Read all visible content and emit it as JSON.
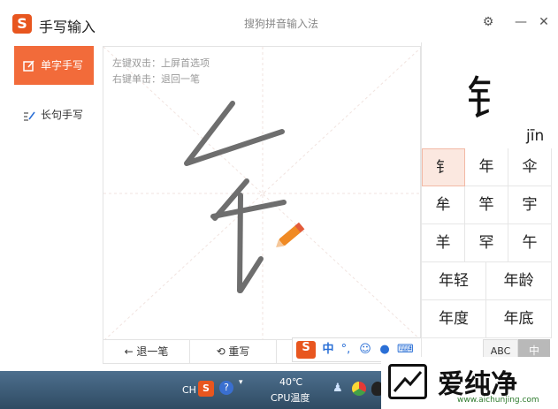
{
  "titlebar": {
    "logo_letter": "S",
    "app_title": "手写输入",
    "ime_title": "搜狗拼音输入法",
    "settings_glyph": "⚙",
    "minimize_glyph": "—",
    "close_glyph": "✕"
  },
  "sidebar": {
    "items": [
      {
        "label": "单字手写",
        "icon": "single-char-icon",
        "active": true
      },
      {
        "label": "长句手写",
        "icon": "long-sentence-icon",
        "active": false
      }
    ]
  },
  "pad": {
    "hint_line1": "左键双击：上屏首选项",
    "hint_line2": "右键单击：退回一笔"
  },
  "bottom_bar": {
    "undo_label": "← 退一笔",
    "rewrite_label": "⟲ 重写"
  },
  "toolstrip": {
    "logo_letter": "S",
    "mode": "中"
  },
  "candidates": {
    "preview_char": "钅",
    "pinyin": "jīn",
    "rows": [
      [
        "钅",
        "年",
        "伞"
      ],
      [
        "牟",
        "竿",
        "宇"
      ],
      [
        "羊",
        "罕",
        "午"
      ],
      [
        "年轻",
        "年龄"
      ],
      [
        "年度",
        "年底"
      ]
    ],
    "selected_index": 0
  },
  "mode_buttons": {
    "abc": "ABC",
    "zh": "中"
  },
  "taskbar": {
    "lang": "CH",
    "temp": "40℃",
    "temp_label": "CPU温度"
  },
  "watermark": {
    "text": "爱纯净",
    "url": "www.aichunjing.com"
  },
  "colors": {
    "accent": "#f26b3a",
    "logo": "#e8561f",
    "taskbar": "#3c5a75"
  }
}
